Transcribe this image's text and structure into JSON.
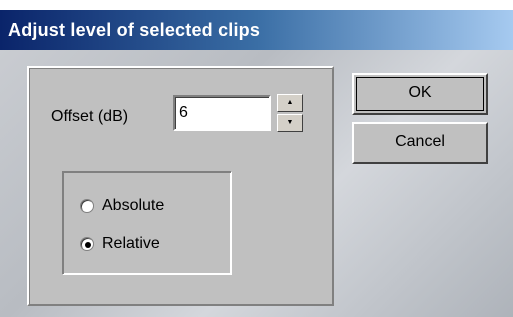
{
  "window": {
    "title": "Adjust level of selected clips"
  },
  "offset": {
    "label": "Offset (dB)",
    "value": "6"
  },
  "mode": {
    "options": [
      {
        "label": "Absolute",
        "selected": false
      },
      {
        "label": "Relative",
        "selected": true
      }
    ]
  },
  "buttons": {
    "ok_label": "OK",
    "cancel_label": "Cancel"
  },
  "icons": {
    "spin_up": "spin-up-arrow-icon",
    "spin_down": "spin-down-arrow-icon"
  },
  "colors": {
    "titlebar_start": "#0a246a",
    "titlebar_end": "#a6caf0",
    "face": "#c0c0c0"
  }
}
